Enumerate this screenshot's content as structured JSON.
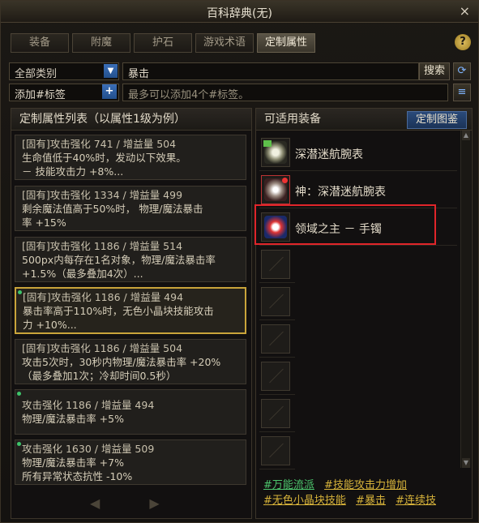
{
  "window": {
    "title": "百科辞典(无)",
    "close_glyph": "×"
  },
  "tabs": [
    "装备",
    "附魔",
    "护石",
    "游戏术语",
    "定制属性"
  ],
  "active_tab": "定制属性",
  "help_glyph": "?",
  "filter": {
    "category": "全部类别",
    "search_value": "暴击",
    "search_button": "搜索"
  },
  "tags_input": {
    "label": "添加#标签",
    "placeholder": "最多可以添加4个#标签。"
  },
  "attr_list": {
    "header": "定制属性列表（以属性1级为例）",
    "items": [
      {
        "l1": "[固有]攻击强化 741 / 增益量 504",
        "l2": "生命值低于40%时，发动以下效果。",
        "l3": "－ 技能攻击力 +8%...",
        "dot": false,
        "selected": false
      },
      {
        "l1": "[固有]攻击强化 1334 / 增益量 499",
        "l2": "剩余魔法值高于50%时， 物理/魔法暴击",
        "l3": "率 +15%",
        "dot": false,
        "selected": false
      },
      {
        "l1": "[固有]攻击强化 1186 / 增益量 514",
        "l2": "500px内每存在1名对象，物理/魔法暴击率",
        "l3": "+1.5%（最多叠加4次）...",
        "dot": false,
        "selected": false
      },
      {
        "l1": "[固有]攻击强化 1186 / 增益量 494",
        "l2": "暴击率高于110%时，无色小晶块技能攻击",
        "l3": "力 +10%...",
        "dot": true,
        "selected": true
      },
      {
        "l1": "[固有]攻击强化 1186 / 增益量 504",
        "l2": "攻击5次时，30秒内物理/魔法暴击率 +20%",
        "l3": "（最多叠加1次；冷却时间0.5秒）",
        "dot": false,
        "selected": false
      },
      {
        "l1": "攻击强化 1186 / 增益量 494",
        "l2": "物理/魔法暴击率 +5%",
        "l3": "",
        "dot": true,
        "selected": false
      },
      {
        "l1": "攻击强化 1630 / 增益量 509",
        "l2": "物理/魔法暴击率 +7%",
        "l3": "所有异常状态抗性 -10%",
        "dot": true,
        "selected": false
      }
    ],
    "pager_prev": "◀",
    "pager_next": "▶"
  },
  "equip_panel": {
    "header": "可适用装备",
    "map_button": "定制图鉴",
    "items": [
      "深潜迷航腕表",
      "神：深潜迷航腕表",
      "领域之主 － 手镯"
    ],
    "empty_slots": 6
  },
  "tag_links": [
    {
      "text": "#万能流派",
      "color": "green"
    },
    {
      "text": "#技能攻击力增加",
      "color": "yellow"
    },
    {
      "text": "#无色小晶块技能",
      "color": "yellow"
    },
    {
      "text": "#暴击",
      "color": "yellow"
    },
    {
      "text": "#连续技",
      "color": "yellow"
    }
  ]
}
